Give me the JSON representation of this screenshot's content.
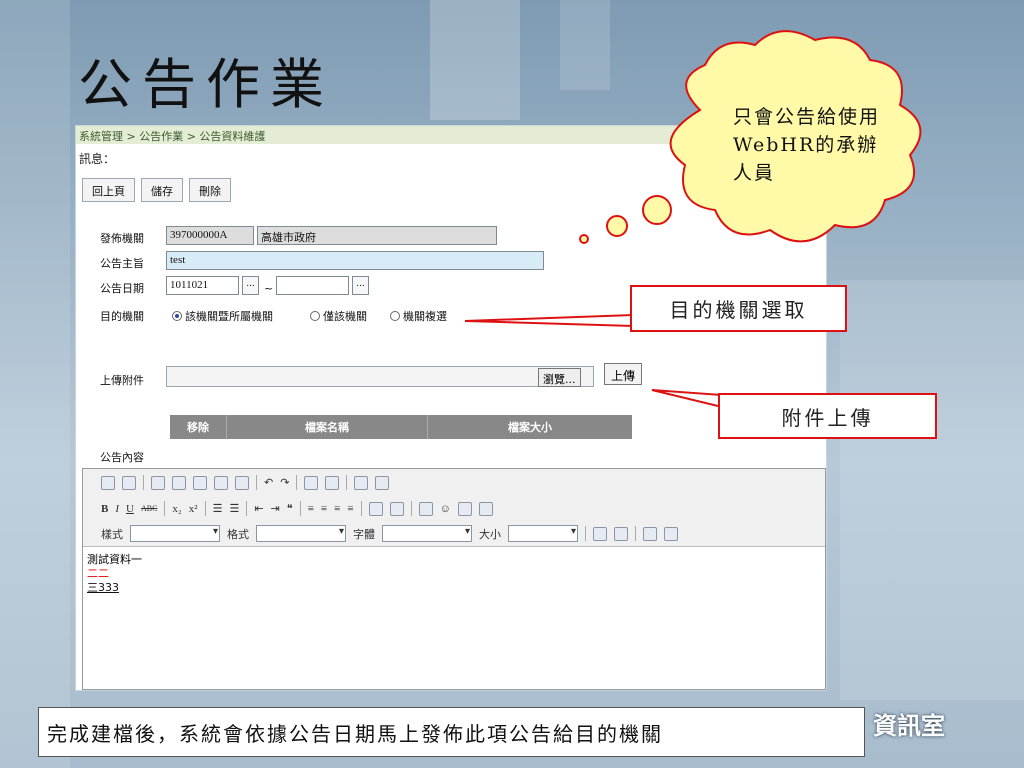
{
  "slide_title": "公告作業",
  "breadcrumb": "系統管理 > 公告作業 > 公告資料維護",
  "message_label": "訊息：",
  "buttons": {
    "back": "回上頁",
    "save": "儲存",
    "delete": "刪除"
  },
  "form": {
    "agency_label": "發佈機關",
    "agency_code": "397000000A",
    "agency_name": "高雄市政府",
    "subject_label": "公告主旨",
    "subject_value": "test",
    "date_label": "公告日期",
    "date_from": "1011021",
    "date_to": "",
    "date_sep": "~",
    "dots": "...",
    "target_label": "目的機關",
    "target_options": [
      "該機關暨所屬機關",
      "僅該機關",
      "機關複選"
    ],
    "target_selected": 0,
    "attach_label": "上傳附件",
    "browse_label": "瀏覽...",
    "upload_label": "上傳",
    "file_columns": [
      "移除",
      "檔案名稱",
      "檔案大小"
    ],
    "content_label": "公告內容"
  },
  "editor": {
    "style_label": "樣式",
    "format_label": "格式",
    "font_label": "字體",
    "size_label": "大小",
    "lines": [
      "測試資料一",
      "二二",
      "三333"
    ]
  },
  "callouts": {
    "cloud": "只會公告給使用WebHR的承辦人員",
    "target": "目的機關選取",
    "attach": "附件上傳"
  },
  "bottom_note": "完成建檔後，系統會依據公告日期馬上發佈此項公告給目的機關",
  "brand": "資訊室",
  "colors": {
    "accent_red": "#dd1111",
    "cloud_fill": "#fff9a8",
    "subject_bg": "#d8ecf8"
  }
}
